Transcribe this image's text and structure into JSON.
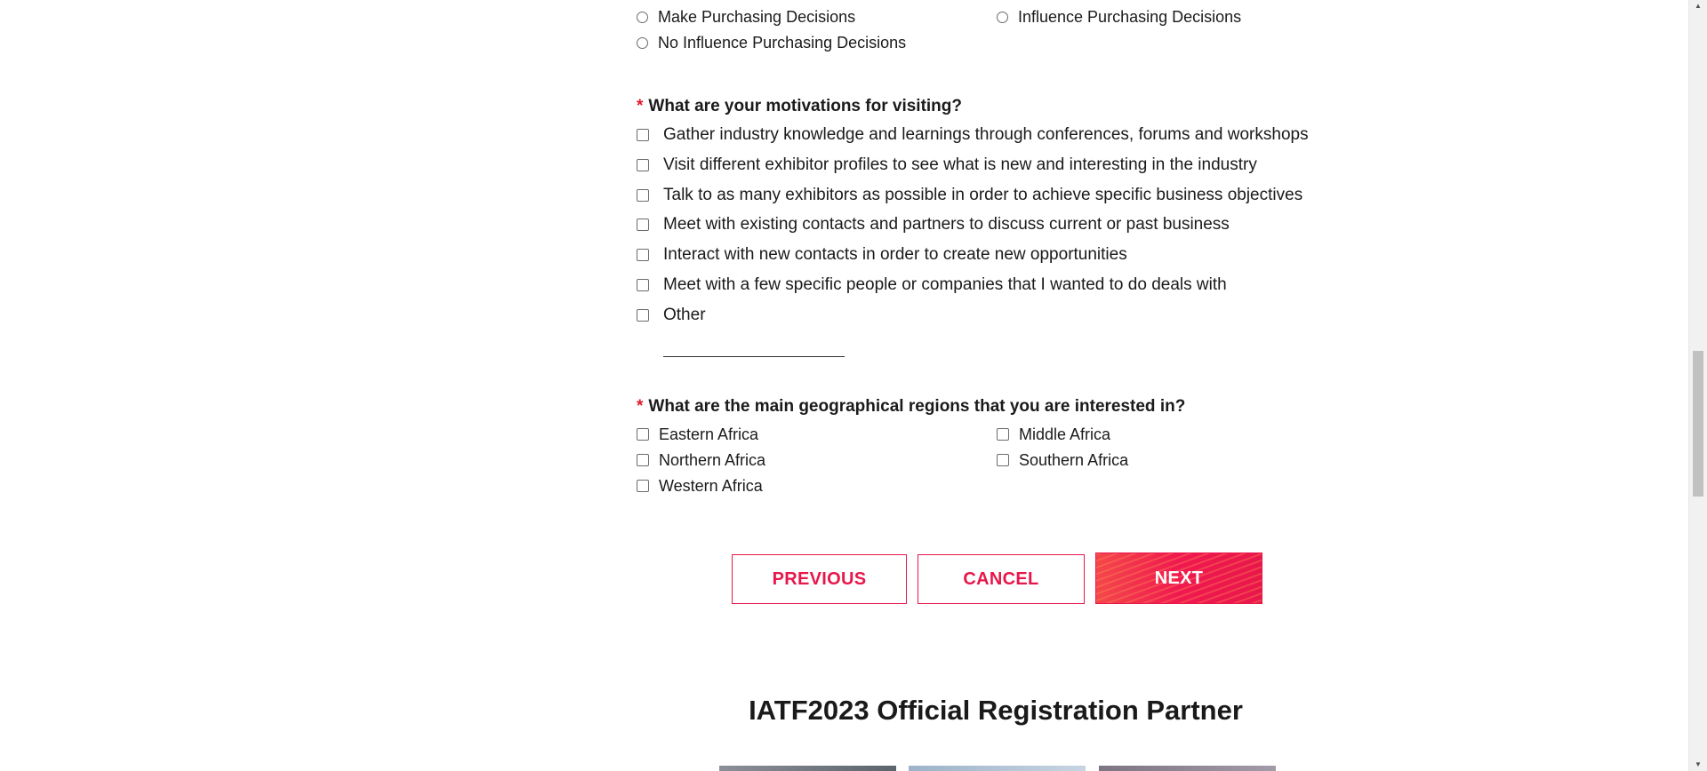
{
  "purchasing": {
    "options": [
      "Make Purchasing Decisions",
      "Influence Purchasing Decisions",
      "No Influence Purchasing Decisions"
    ]
  },
  "motivations": {
    "required_mark": "*",
    "question": "What are your motivations for visiting?",
    "options": [
      "Gather industry knowledge and learnings through conferences, forums and workshops",
      "Visit different exhibitor profiles to see what is new and interesting in the industry",
      "Talk to as many exhibitors as possible in order to achieve specific business objectives",
      "Meet with existing contacts and partners to discuss current or past business",
      "Interact with new contacts in order to create new opportunities",
      "Meet with a few specific people or companies that I wanted to do deals with",
      "Other"
    ],
    "other_value": ""
  },
  "regions": {
    "required_mark": "*",
    "question": "What are the main geographical regions that you are interested in?",
    "options": [
      "Eastern Africa",
      "Middle Africa",
      "Northern Africa",
      "Southern Africa",
      "Western Africa"
    ]
  },
  "buttons": {
    "previous": "PREVIOUS",
    "cancel": "CANCEL",
    "next": "NEXT"
  },
  "partner": {
    "title": "IATF2023 Official Registration Partner"
  },
  "colors": {
    "accent": "#e8174a",
    "required": "#e0192e"
  },
  "scrollbar": {
    "up_icon": "scroll-up-arrow-icon",
    "down_icon": "scroll-down-arrow-icon"
  }
}
